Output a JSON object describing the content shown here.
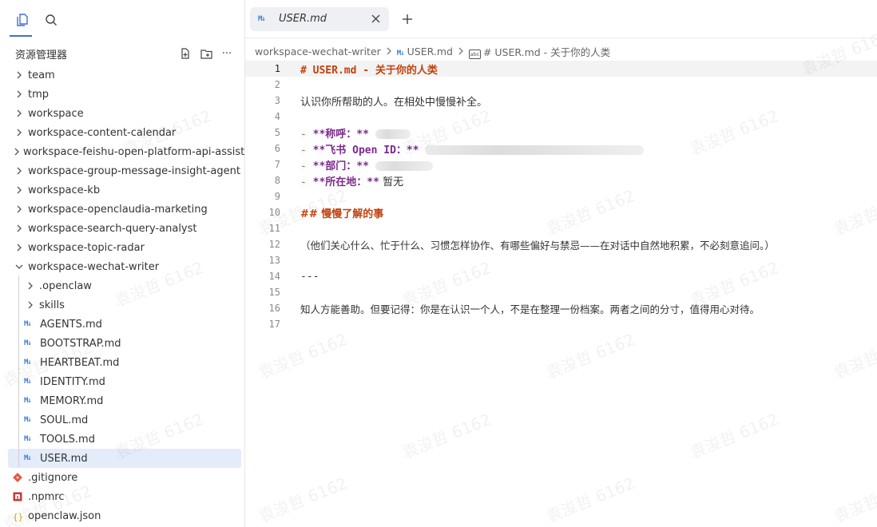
{
  "sidebar": {
    "title": "资源管理器",
    "tree": [
      {
        "label": "team",
        "kind": "folder"
      },
      {
        "label": "tmp",
        "kind": "folder"
      },
      {
        "label": "workspace",
        "kind": "folder"
      },
      {
        "label": "workspace-content-calendar",
        "kind": "folder"
      },
      {
        "label": "workspace-feishu-open-platform-api-assistant",
        "kind": "folder"
      },
      {
        "label": "workspace-group-message-insight-agent",
        "kind": "folder"
      },
      {
        "label": "workspace-kb",
        "kind": "folder"
      },
      {
        "label": "workspace-openclaudia-marketing",
        "kind": "folder"
      },
      {
        "label": "workspace-search-query-analyst",
        "kind": "folder"
      },
      {
        "label": "workspace-topic-radar",
        "kind": "folder"
      },
      {
        "label": "workspace-wechat-writer",
        "kind": "folder-open"
      }
    ],
    "children": [
      {
        "label": ".openclaw",
        "kind": "folder"
      },
      {
        "label": "skills",
        "kind": "folder"
      },
      {
        "label": "AGENTS.md",
        "kind": "md"
      },
      {
        "label": "BOOTSTRAP.md",
        "kind": "md"
      },
      {
        "label": "HEARTBEAT.md",
        "kind": "md"
      },
      {
        "label": "IDENTITY.md",
        "kind": "md"
      },
      {
        "label": "MEMORY.md",
        "kind": "md"
      },
      {
        "label": "SOUL.md",
        "kind": "md"
      },
      {
        "label": "TOOLS.md",
        "kind": "md"
      },
      {
        "label": "USER.md",
        "kind": "md",
        "selected": true
      }
    ],
    "root_files": [
      {
        "label": ".gitignore",
        "icon": "git-icon",
        "color": "#e05d44"
      },
      {
        "label": ".npmrc",
        "icon": "npm-icon",
        "color": "#cb3837"
      },
      {
        "label": "openclaw.json",
        "icon": "json-icon",
        "color": "#d9a400"
      }
    ]
  },
  "tab": {
    "label": "USER.md",
    "icon": "M↓"
  },
  "breadcrumb": {
    "folder": "workspace-wechat-writer",
    "file": "USER.md",
    "symbol": "# USER.md - 关于你的人类",
    "symbol_icon": "abc"
  },
  "editor": {
    "line_numbers": [
      "1",
      "2",
      "3",
      "4",
      "5",
      "6",
      "7",
      "8",
      "9",
      "10",
      "11",
      "12",
      "13",
      "14",
      "15",
      "16",
      "17"
    ],
    "heading1": "# USER.md - 关于你的人类",
    "intro": "认识你所帮助的人。在相处中慢慢补全。",
    "bullet_dash": "- ",
    "field_name": "**称呼：**",
    "field_feishu": "**飞书 Open ID：**",
    "field_dept": "**部门：**",
    "field_location": "**所在地：**",
    "location_value": " 暂无",
    "heading2": "## 慢慢了解的事",
    "para": "（他们关心什么、忙于什么、习惯怎样协作、有哪些偏好与禁忌——在对话中自然地积累，不必刻意追问。）",
    "hr": "---",
    "closing": "知人方能善助。但要记得：你是在认识一个人，不是在整理一份档案。两者之间的分寸，值得用心对待。"
  },
  "watermark": "袁浚哲 6162",
  "colors": {
    "accent": "#3f6fd8",
    "heading": "#c2410c",
    "bold": "#7b2a8c",
    "selection": "#e4ebfa"
  }
}
